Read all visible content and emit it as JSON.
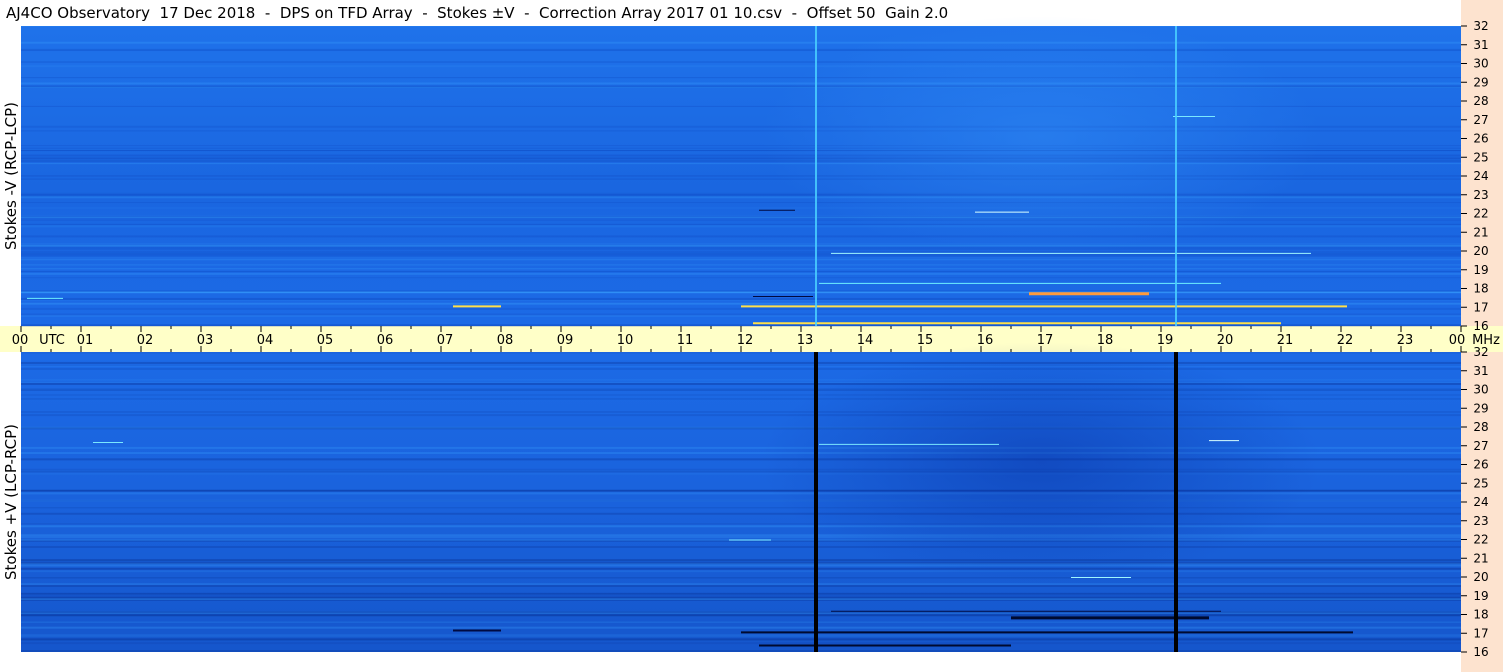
{
  "title": "AJ4CO Observatory  17 Dec 2018  -  DPS on TFD Array  -  Stokes ±V  -  Correction Array 2017 01 10.csv  -  Offset 50  Gain 2.0",
  "chart_data": [
    {
      "type": "heatmap",
      "ylabel": "Stokes -V (RCP-LCP)",
      "yunit_ticks": [
        "32",
        "31",
        "30",
        "29",
        "28",
        "27",
        "26",
        "25",
        "24",
        "23",
        "22",
        "21",
        "20",
        "19",
        "18",
        "17",
        "16"
      ],
      "ylim": [
        16,
        32
      ],
      "xlim": [
        0,
        24
      ],
      "colors": {
        "base": "#1e6fe6",
        "dark": "#0b3fb8",
        "light": "#3aa0ff",
        "hot": "#ffe04a",
        "line": "#4ad0ff"
      },
      "vertical_lines_hours": [
        13.25,
        19.25
      ]
    },
    {
      "type": "heatmap",
      "ylabel": "Stokes +V (LCP-RCP)",
      "yunit_ticks": [
        "32",
        "31",
        "30",
        "29",
        "28",
        "27",
        "26",
        "25",
        "24",
        "23",
        "22",
        "21",
        "20",
        "19",
        "18",
        "17",
        "16"
      ],
      "ylim": [
        16,
        32
      ],
      "xlim": [
        0,
        24
      ],
      "colors": {
        "base": "#1e6fe6",
        "dark": "#072a8a",
        "light": "#3aa0ff",
        "line": "#000000"
      },
      "vertical_lines_hours": [
        13.25,
        19.25
      ]
    }
  ],
  "time_axis": {
    "labels": [
      "00",
      "UTC",
      "01",
      "02",
      "03",
      "04",
      "05",
      "06",
      "07",
      "08",
      "09",
      "10",
      "11",
      "12",
      "13",
      "14",
      "15",
      "16",
      "17",
      "18",
      "19",
      "20",
      "21",
      "22",
      "23",
      "00",
      "MHz"
    ],
    "hours": [
      0,
      1,
      2,
      3,
      4,
      5,
      6,
      7,
      8,
      9,
      10,
      11,
      12,
      13,
      14,
      15,
      16,
      17,
      18,
      19,
      20,
      21,
      22,
      23,
      24
    ]
  }
}
